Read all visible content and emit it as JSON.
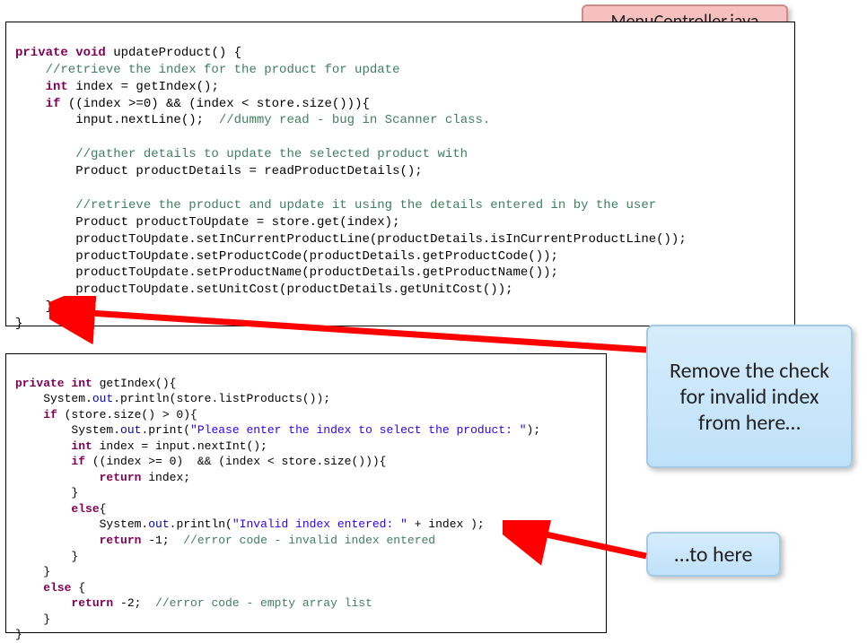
{
  "file_badge": "MenuController.java",
  "callout_top": "Remove the check for invalid index from here…",
  "callout_bottom": "…to here",
  "code_top": {
    "l1a": "private",
    "l1b": " void",
    "l1c": " updateProduct() {",
    "l2": "    //retrieve the index for the product for update",
    "l3a": "    int",
    "l3b": " index = getIndex();",
    "l4a": "    if",
    "l4b": " ((index >=0) && (index < store.size())){",
    "l5a": "        input.nextLine();  ",
    "l5b": "//dummy read - bug in Scanner class.",
    "l6": " ",
    "l7": "        //gather details to update the selected product with",
    "l8": "        Product productDetails = readProductDetails();",
    "l9": " ",
    "l10": "        //retrieve the product and update it using the details entered in by the user",
    "l11": "        Product productToUpdate = store.get(index);",
    "l12": "        productToUpdate.setInCurrentProductLine(productDetails.isInCurrentProductLine());",
    "l13": "        productToUpdate.setProductCode(productDetails.getProductCode());",
    "l14": "        productToUpdate.setProductName(productDetails.getProductName());",
    "l15": "        productToUpdate.setUnitCost(productDetails.getUnitCost());",
    "l16": "    }",
    "l17": "}"
  },
  "code_bottom": {
    "l1a": "private",
    "l1b": " int",
    "l1c": " getIndex(){",
    "l2a": "    System.",
    "l2b": "out",
    "l2c": ".println(store.listProducts());",
    "l3a": "    if",
    "l3b": " (store.size() > 0){",
    "l4a": "        System.",
    "l4b": "out",
    "l4c": ".print(",
    "l4d": "\"Please enter the index to select the product: \"",
    "l4e": ");",
    "l5a": "        int",
    "l5b": " index = input.nextInt();",
    "l6a": "        if",
    "l6b": " ((index >= 0)  && (index < store.size())){",
    "l7a": "            return",
    "l7b": " index;",
    "l8": "        }",
    "l9a": "        else",
    "l9b": "{",
    "l10a": "            System.",
    "l10b": "out",
    "l10c": ".println(",
    "l10d": "\"Invalid index entered: \"",
    "l10e": " + index );",
    "l11a": "            return",
    "l11b": " -1;  ",
    "l11c": "//error code - invalid index entered",
    "l12": "        }",
    "l13": "    }",
    "l14a": "    else",
    "l14b": " {",
    "l15a": "        return",
    "l15b": " -2;  ",
    "l15c": "//error code - empty array list",
    "l16": "    }",
    "l17": "}"
  }
}
